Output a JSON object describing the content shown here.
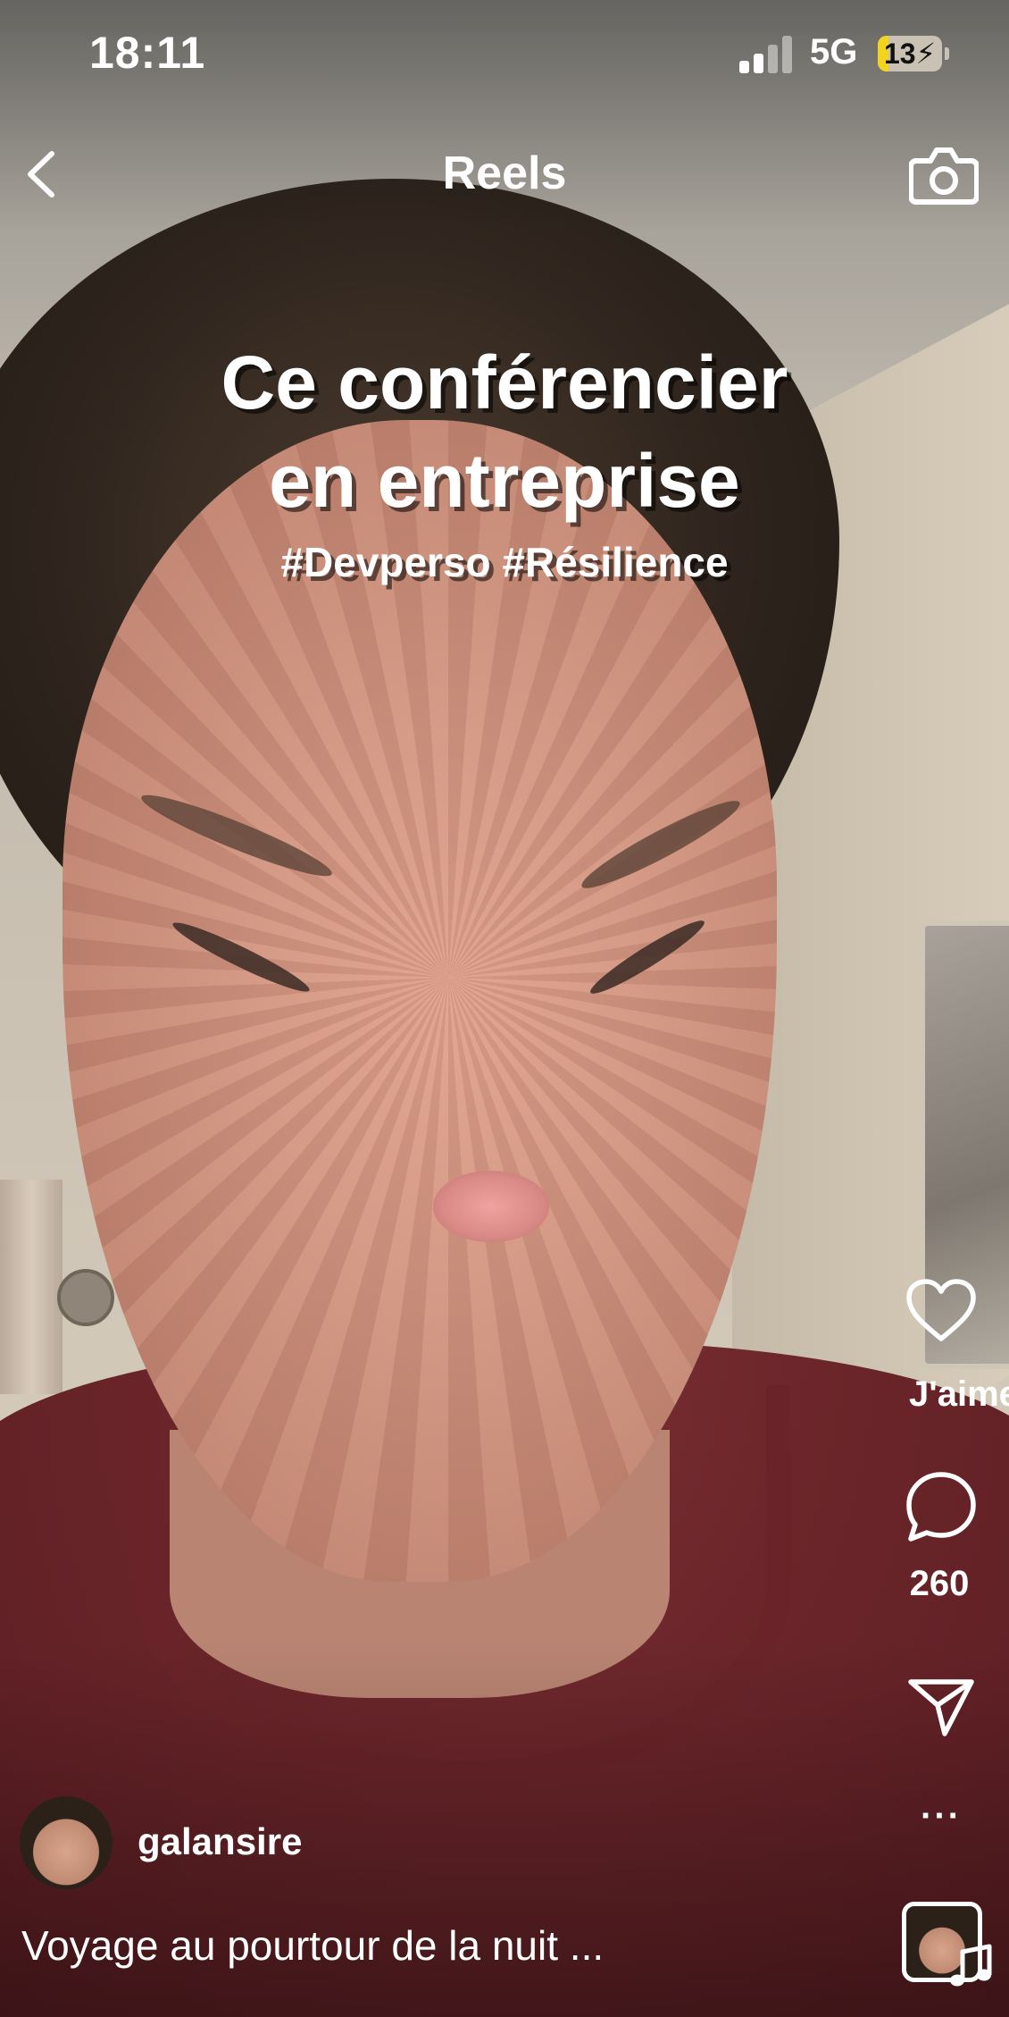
{
  "status_bar": {
    "time": "18:11",
    "network": "5G",
    "battery": "13",
    "charging_glyph": "⚡"
  },
  "nav": {
    "title": "Reels",
    "back_icon": "chevron-left-icon",
    "camera_icon": "camera-icon"
  },
  "caption": {
    "line1": "Ce conférencier",
    "line2": "en entreprise",
    "hashtags": "#Devperso #Résilience"
  },
  "actions": {
    "like_label": "J'aime",
    "comment_count": "260",
    "share_icon": "send-icon",
    "more_label": "···"
  },
  "post": {
    "username": "galansire",
    "description": "Voyage au pourtour de la nuit ..."
  }
}
